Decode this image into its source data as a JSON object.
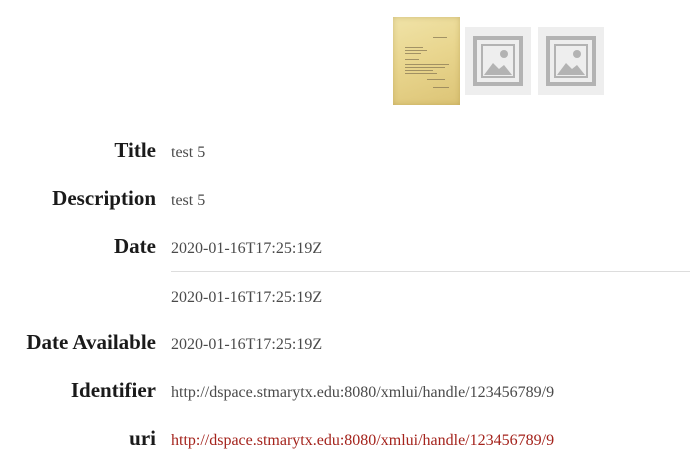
{
  "thumbnails": [
    {
      "kind": "document-scan",
      "icon": "document-thumbnail"
    },
    {
      "kind": "placeholder",
      "icon": "image-placeholder-icon"
    },
    {
      "kind": "placeholder",
      "icon": "image-placeholder-icon"
    }
  ],
  "metadata": {
    "title": {
      "label": "Title",
      "values": [
        "test 5"
      ]
    },
    "description": {
      "label": "Description",
      "values": [
        "test 5"
      ]
    },
    "date": {
      "label": "Date",
      "values": [
        "2020-01-16T17:25:19Z",
        "2020-01-16T17:25:19Z"
      ]
    },
    "date_available": {
      "label": "Date Available",
      "values": [
        "2020-01-16T17:25:19Z"
      ]
    },
    "identifier": {
      "label": "Identifier",
      "values": [
        "http://dspace.stmarytx.edu:8080/xmlui/handle/123456789/9"
      ]
    },
    "uri": {
      "label": "uri",
      "values": [
        "http://dspace.stmarytx.edu:8080/xmlui/handle/123456789/9"
      ]
    }
  },
  "colors": {
    "link": "#a4231c",
    "label": "#1a1a1a",
    "value": "#4a4a4a",
    "placeholder_bg": "#eeeeee",
    "placeholder_icon": "#b3b3b3"
  }
}
